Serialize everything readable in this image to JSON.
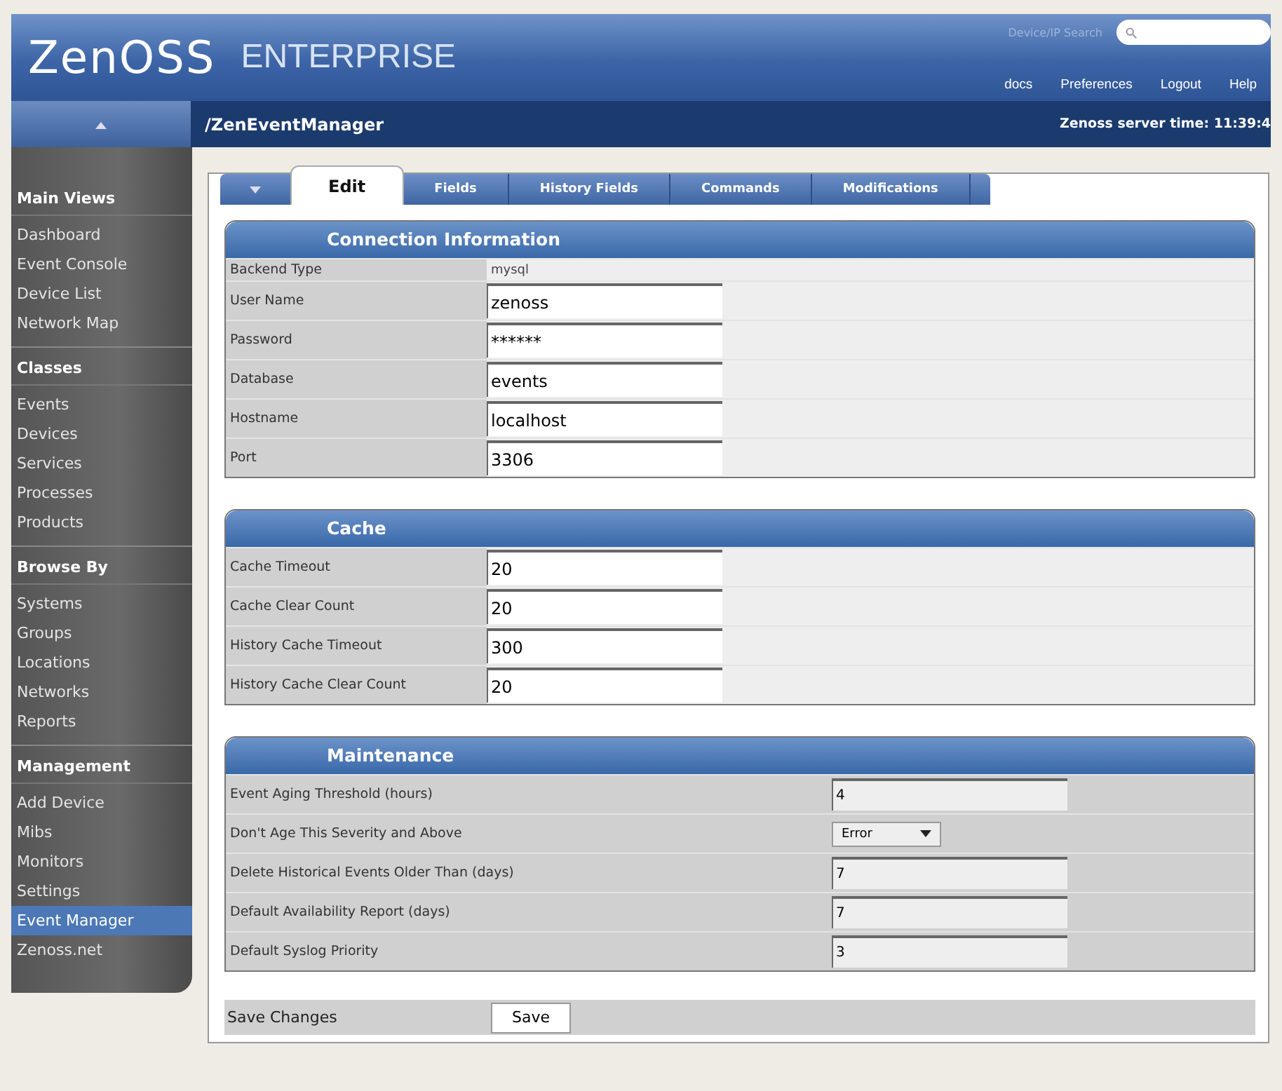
{
  "header": {
    "logo": "ZenOSS",
    "product": "ENTERPRISE",
    "search_label": "Device/IP Search",
    "links": [
      "docs",
      "Preferences",
      "Logout",
      "Help"
    ]
  },
  "breadcrumb": "/ZenEventManager",
  "server_time": "Zenoss server time: 11:39:4",
  "sidebar": [
    {
      "heading": "Main Views",
      "items": [
        {
          "label": "Dashboard",
          "selected": false
        },
        {
          "label": "Event Console",
          "selected": false
        },
        {
          "label": "Device List",
          "selected": false
        },
        {
          "label": "Network Map",
          "selected": false
        }
      ]
    },
    {
      "heading": "Classes",
      "items": [
        {
          "label": "Events",
          "selected": false
        },
        {
          "label": "Devices",
          "selected": false
        },
        {
          "label": "Services",
          "selected": false
        },
        {
          "label": "Processes",
          "selected": false
        },
        {
          "label": "Products",
          "selected": false
        }
      ]
    },
    {
      "heading": "Browse By",
      "items": [
        {
          "label": "Systems",
          "selected": false
        },
        {
          "label": "Groups",
          "selected": false
        },
        {
          "label": "Locations",
          "selected": false
        },
        {
          "label": "Networks",
          "selected": false
        },
        {
          "label": "Reports",
          "selected": false
        }
      ]
    },
    {
      "heading": "Management",
      "items": [
        {
          "label": "Add Device",
          "selected": false
        },
        {
          "label": "Mibs",
          "selected": false
        },
        {
          "label": "Monitors",
          "selected": false
        },
        {
          "label": "Settings",
          "selected": false
        },
        {
          "label": "Event Manager",
          "selected": true
        },
        {
          "label": "Zenoss.net",
          "selected": false
        }
      ]
    }
  ],
  "tabs": [
    {
      "label": "Edit",
      "selected": true
    },
    {
      "label": "Fields",
      "selected": false
    },
    {
      "label": "History Fields",
      "selected": false
    },
    {
      "label": "Commands",
      "selected": false
    },
    {
      "label": "Modifications",
      "selected": false
    }
  ],
  "sections": [
    {
      "title": "Connection Information",
      "wide": false,
      "rows": [
        {
          "label": "Backend Type",
          "kind": "text",
          "value": "mysql"
        },
        {
          "label": "User Name",
          "kind": "input",
          "value": "zenoss"
        },
        {
          "label": "Password",
          "kind": "input",
          "value": "******"
        },
        {
          "label": "Database",
          "kind": "input",
          "value": "events"
        },
        {
          "label": "Hostname",
          "kind": "input",
          "value": "localhost"
        },
        {
          "label": "Port",
          "kind": "input",
          "value": "3306"
        }
      ]
    },
    {
      "title": "Cache",
      "wide": false,
      "rows": [
        {
          "label": "Cache Timeout",
          "kind": "input",
          "value": "20"
        },
        {
          "label": "Cache Clear Count",
          "kind": "input",
          "value": "20"
        },
        {
          "label": "History Cache Timeout",
          "kind": "input",
          "value": "300"
        },
        {
          "label": "History Cache Clear Count",
          "kind": "input",
          "value": "20"
        }
      ]
    },
    {
      "title": "Maintenance",
      "wide": true,
      "rows": [
        {
          "label": "Event Aging Threshold (hours)",
          "kind": "input",
          "value": "4"
        },
        {
          "label": "Don't Age This Severity and Above",
          "kind": "select",
          "value": "Error"
        },
        {
          "label": "Delete Historical Events Older Than (days)",
          "kind": "input",
          "value": "7"
        },
        {
          "label": "Default Availability Report (days)",
          "kind": "input",
          "value": "7"
        },
        {
          "label": "Default Syslog Priority",
          "kind": "input",
          "value": "3"
        }
      ]
    }
  ],
  "save": {
    "label": "Save Changes",
    "button": "Save"
  }
}
